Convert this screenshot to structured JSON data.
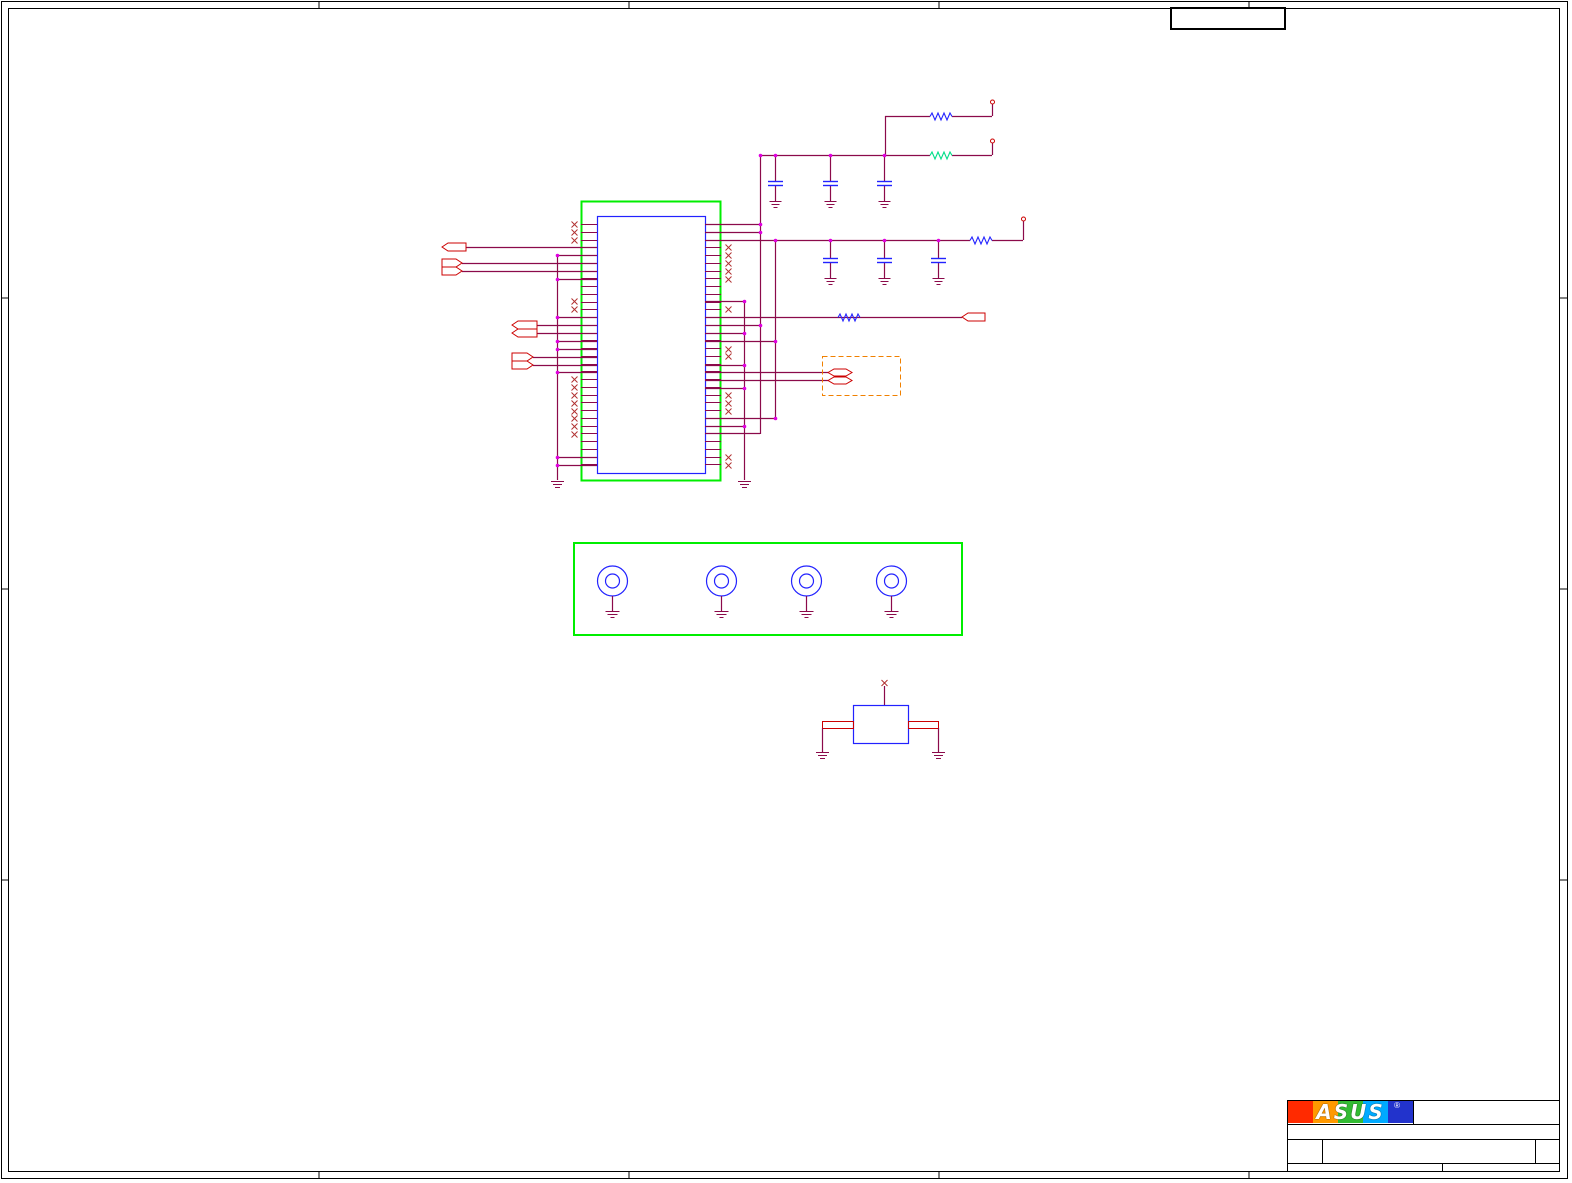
{
  "sheet": {
    "logo": {
      "text": "ASUS",
      "registered": "®"
    },
    "colors": {
      "wire": "#8b0a4a",
      "component": "#2222ff",
      "pin": "#cc0000",
      "junction": "#e000e0",
      "box_highlight": "#00ee00",
      "dashed_box": "#f08000",
      "inductor": "#00dd88",
      "no_connect": "#b03030",
      "frame": "#000000"
    }
  }
}
